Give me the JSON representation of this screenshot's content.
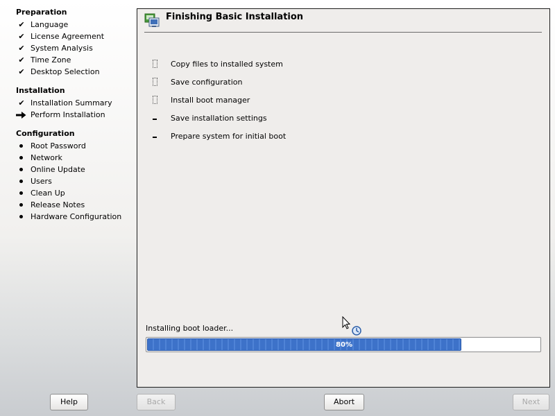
{
  "sidebar": {
    "sections": [
      {
        "title": "Preparation",
        "items": [
          {
            "label": "Language",
            "status": "done"
          },
          {
            "label": "License Agreement",
            "status": "done"
          },
          {
            "label": "System Analysis",
            "status": "done"
          },
          {
            "label": "Time Zone",
            "status": "done"
          },
          {
            "label": "Desktop Selection",
            "status": "done"
          }
        ]
      },
      {
        "title": "Installation",
        "items": [
          {
            "label": "Installation Summary",
            "status": "done"
          },
          {
            "label": "Perform Installation",
            "status": "current"
          }
        ]
      },
      {
        "title": "Configuration",
        "items": [
          {
            "label": "Root Password",
            "status": "pending"
          },
          {
            "label": "Network",
            "status": "pending"
          },
          {
            "label": "Online Update",
            "status": "pending"
          },
          {
            "label": "Users",
            "status": "pending"
          },
          {
            "label": "Clean Up",
            "status": "pending"
          },
          {
            "label": "Release Notes",
            "status": "pending"
          },
          {
            "label": "Hardware Configuration",
            "status": "pending"
          }
        ]
      }
    ],
    "marks": {
      "done": "✔",
      "current": "arrow",
      "pending": "bullet"
    }
  },
  "main": {
    "title": "Finishing Basic Installation",
    "title_icon": "installer-icon",
    "tasks": [
      {
        "label": "Copy files to installed system",
        "state": "in-progress"
      },
      {
        "label": "Save configuration",
        "state": "in-progress"
      },
      {
        "label": "Install boot manager",
        "state": "in-progress"
      },
      {
        "label": "Save installation settings",
        "state": "pending"
      },
      {
        "label": "Prepare system for initial boot",
        "state": "pending"
      }
    ],
    "progress": {
      "label": "Installing boot loader...",
      "value": 80,
      "text": "80%"
    }
  },
  "buttons": {
    "help": "Help",
    "back": "Back",
    "abort": "Abort",
    "next": "Next"
  },
  "colors": {
    "progress_fill": "#3d72c9",
    "panel_bg": "#efedeb"
  }
}
